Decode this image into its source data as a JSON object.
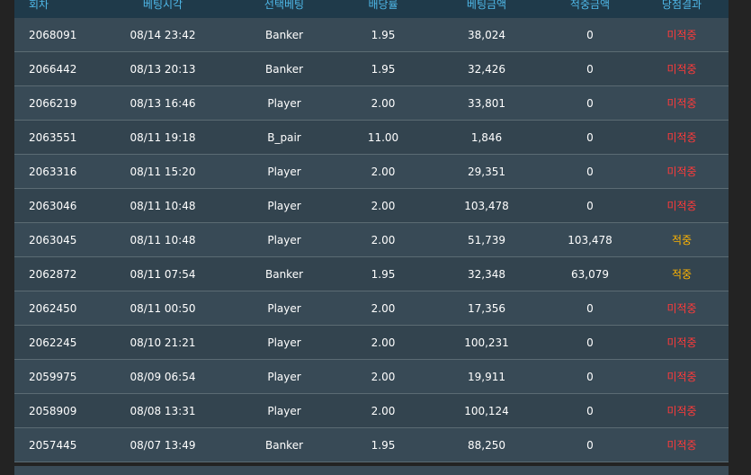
{
  "columns": [
    "회차",
    "베팅시각",
    "선택베팅",
    "배당률",
    "베팅금액",
    "적중금액",
    "당첨결과"
  ],
  "rows": [
    {
      "round": "2068091",
      "time": "08/14 23:42",
      "pick": "Banker",
      "odds": "1.95",
      "amount": "38,024",
      "win": "0",
      "result": "미적중",
      "hit": false
    },
    {
      "round": "2066442",
      "time": "08/13 20:13",
      "pick": "Banker",
      "odds": "1.95",
      "amount": "32,426",
      "win": "0",
      "result": "미적중",
      "hit": false
    },
    {
      "round": "2066219",
      "time": "08/13 16:46",
      "pick": "Player",
      "odds": "2.00",
      "amount": "33,801",
      "win": "0",
      "result": "미적중",
      "hit": false
    },
    {
      "round": "2063551",
      "time": "08/11 19:18",
      "pick": "B_pair",
      "odds": "11.00",
      "amount": "1,846",
      "win": "0",
      "result": "미적중",
      "hit": false
    },
    {
      "round": "2063316",
      "time": "08/11 15:20",
      "pick": "Player",
      "odds": "2.00",
      "amount": "29,351",
      "win": "0",
      "result": "미적중",
      "hit": false
    },
    {
      "round": "2063046",
      "time": "08/11 10:48",
      "pick": "Player",
      "odds": "2.00",
      "amount": "103,478",
      "win": "0",
      "result": "미적중",
      "hit": false
    },
    {
      "round": "2063045",
      "time": "08/11 10:48",
      "pick": "Player",
      "odds": "2.00",
      "amount": "51,739",
      "win": "103,478",
      "result": "적중",
      "hit": true
    },
    {
      "round": "2062872",
      "time": "08/11 07:54",
      "pick": "Banker",
      "odds": "1.95",
      "amount": "32,348",
      "win": "63,079",
      "result": "적중",
      "hit": true
    },
    {
      "round": "2062450",
      "time": "08/11 00:50",
      "pick": "Player",
      "odds": "2.00",
      "amount": "17,356",
      "win": "0",
      "result": "미적중",
      "hit": false
    },
    {
      "round": "2062245",
      "time": "08/10 21:21",
      "pick": "Player",
      "odds": "2.00",
      "amount": "100,231",
      "win": "0",
      "result": "미적중",
      "hit": false
    },
    {
      "round": "2059975",
      "time": "08/09 06:54",
      "pick": "Player",
      "odds": "2.00",
      "amount": "19,911",
      "win": "0",
      "result": "미적중",
      "hit": false
    },
    {
      "round": "2058909",
      "time": "08/08 13:31",
      "pick": "Player",
      "odds": "2.00",
      "amount": "100,124",
      "win": "0",
      "result": "미적중",
      "hit": false
    },
    {
      "round": "2057445",
      "time": "08/07 13:49",
      "pick": "Banker",
      "odds": "1.95",
      "amount": "88,250",
      "win": "0",
      "result": "미적중",
      "hit": false
    }
  ],
  "colors": {
    "header_bg": "#1f3a4a",
    "header_text": "#4fb8e8",
    "miss": "#ff3a3a",
    "hit": "#ffb400"
  }
}
